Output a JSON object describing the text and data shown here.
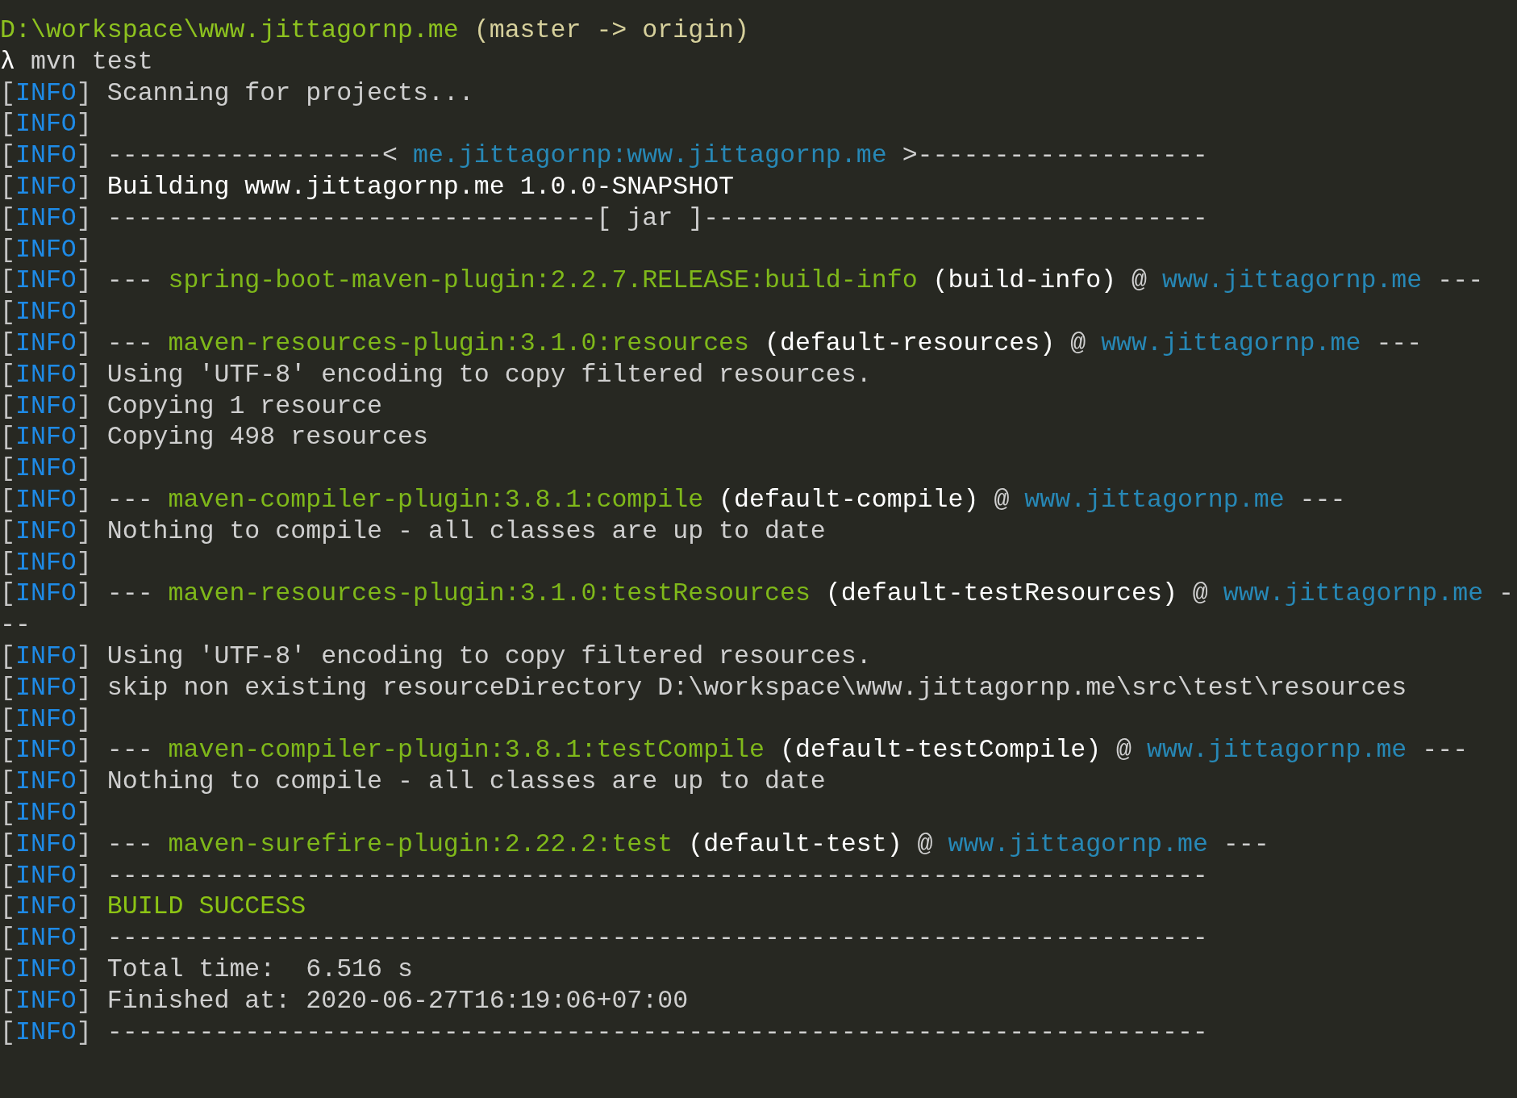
{
  "terminal": {
    "lines": [
      [
        {
          "kind": "path",
          "text": "D:\\workspace\\www.jittagornp.me"
        },
        {
          "kind": "branch",
          "text": " (master -> origin)"
        }
      ],
      [
        {
          "kind": "symbol",
          "text": "λ"
        },
        {
          "kind": "command",
          "text": " mvn test"
        }
      ],
      [
        {
          "kind": "bracket",
          "text": "["
        },
        {
          "kind": "level",
          "text": "INFO"
        },
        {
          "kind": "bracket",
          "text": "]"
        },
        {
          "kind": "text",
          "text": " Scanning for projects..."
        }
      ],
      [
        {
          "kind": "bracket",
          "text": "["
        },
        {
          "kind": "level",
          "text": "INFO"
        },
        {
          "kind": "bracket",
          "text": "]"
        }
      ],
      [
        {
          "kind": "bracket",
          "text": "["
        },
        {
          "kind": "level",
          "text": "INFO"
        },
        {
          "kind": "bracket",
          "text": "]"
        },
        {
          "kind": "text",
          "text": " ------------------< "
        },
        {
          "kind": "artifact",
          "text": "me.jittagornp:www.jittagornp.me"
        },
        {
          "kind": "text",
          "text": " >-------------------"
        }
      ],
      [
        {
          "kind": "bracket",
          "text": "["
        },
        {
          "kind": "level",
          "text": "INFO"
        },
        {
          "kind": "bracket",
          "text": "]"
        },
        {
          "kind": "heading",
          "text": " Building www.jittagornp.me 1.0.0-SNAPSHOT"
        }
      ],
      [
        {
          "kind": "bracket",
          "text": "["
        },
        {
          "kind": "level",
          "text": "INFO"
        },
        {
          "kind": "bracket",
          "text": "]"
        },
        {
          "kind": "text",
          "text": " --------------------------------[ jar ]---------------------------------"
        }
      ],
      [
        {
          "kind": "bracket",
          "text": "["
        },
        {
          "kind": "level",
          "text": "INFO"
        },
        {
          "kind": "bracket",
          "text": "]"
        }
      ],
      [
        {
          "kind": "bracket",
          "text": "["
        },
        {
          "kind": "level",
          "text": "INFO"
        },
        {
          "kind": "bracket",
          "text": "]"
        },
        {
          "kind": "text",
          "text": " --- "
        },
        {
          "kind": "plugin",
          "text": "spring-boot-maven-plugin:2.2.7.RELEASE:build-info"
        },
        {
          "kind": "heading",
          "text": " (build-info)"
        },
        {
          "kind": "text",
          "text": " @ "
        },
        {
          "kind": "artifact",
          "text": "www.jittagornp.me"
        },
        {
          "kind": "text",
          "text": " ---"
        }
      ],
      [
        {
          "kind": "bracket",
          "text": "["
        },
        {
          "kind": "level",
          "text": "INFO"
        },
        {
          "kind": "bracket",
          "text": "]"
        }
      ],
      [
        {
          "kind": "bracket",
          "text": "["
        },
        {
          "kind": "level",
          "text": "INFO"
        },
        {
          "kind": "bracket",
          "text": "]"
        },
        {
          "kind": "text",
          "text": " --- "
        },
        {
          "kind": "plugin",
          "text": "maven-resources-plugin:3.1.0:resources"
        },
        {
          "kind": "heading",
          "text": " (default-resources)"
        },
        {
          "kind": "text",
          "text": " @ "
        },
        {
          "kind": "artifact",
          "text": "www.jittagornp.me"
        },
        {
          "kind": "text",
          "text": " ---"
        }
      ],
      [
        {
          "kind": "bracket",
          "text": "["
        },
        {
          "kind": "level",
          "text": "INFO"
        },
        {
          "kind": "bracket",
          "text": "]"
        },
        {
          "kind": "text",
          "text": " Using 'UTF-8' encoding to copy filtered resources."
        }
      ],
      [
        {
          "kind": "bracket",
          "text": "["
        },
        {
          "kind": "level",
          "text": "INFO"
        },
        {
          "kind": "bracket",
          "text": "]"
        },
        {
          "kind": "text",
          "text": " Copying 1 resource"
        }
      ],
      [
        {
          "kind": "bracket",
          "text": "["
        },
        {
          "kind": "level",
          "text": "INFO"
        },
        {
          "kind": "bracket",
          "text": "]"
        },
        {
          "kind": "text",
          "text": " Copying 498 resources"
        }
      ],
      [
        {
          "kind": "bracket",
          "text": "["
        },
        {
          "kind": "level",
          "text": "INFO"
        },
        {
          "kind": "bracket",
          "text": "]"
        }
      ],
      [
        {
          "kind": "bracket",
          "text": "["
        },
        {
          "kind": "level",
          "text": "INFO"
        },
        {
          "kind": "bracket",
          "text": "]"
        },
        {
          "kind": "text",
          "text": " --- "
        },
        {
          "kind": "plugin",
          "text": "maven-compiler-plugin:3.8.1:compile"
        },
        {
          "kind": "heading",
          "text": " (default-compile)"
        },
        {
          "kind": "text",
          "text": " @ "
        },
        {
          "kind": "artifact",
          "text": "www.jittagornp.me"
        },
        {
          "kind": "text",
          "text": " ---"
        }
      ],
      [
        {
          "kind": "bracket",
          "text": "["
        },
        {
          "kind": "level",
          "text": "INFO"
        },
        {
          "kind": "bracket",
          "text": "]"
        },
        {
          "kind": "text",
          "text": " Nothing to compile - all classes are up to date"
        }
      ],
      [
        {
          "kind": "bracket",
          "text": "["
        },
        {
          "kind": "level",
          "text": "INFO"
        },
        {
          "kind": "bracket",
          "text": "]"
        }
      ],
      [
        {
          "kind": "bracket",
          "text": "["
        },
        {
          "kind": "level",
          "text": "INFO"
        },
        {
          "kind": "bracket",
          "text": "]"
        },
        {
          "kind": "text",
          "text": " --- "
        },
        {
          "kind": "plugin",
          "text": "maven-resources-plugin:3.1.0:testResources"
        },
        {
          "kind": "heading",
          "text": " (default-testResources)"
        },
        {
          "kind": "text",
          "text": " @ "
        },
        {
          "kind": "artifact",
          "text": "www.jittagornp.me"
        },
        {
          "kind": "text",
          "text": " -"
        }
      ],
      [
        {
          "kind": "text",
          "text": "--"
        }
      ],
      [
        {
          "kind": "bracket",
          "text": "["
        },
        {
          "kind": "level",
          "text": "INFO"
        },
        {
          "kind": "bracket",
          "text": "]"
        },
        {
          "kind": "text",
          "text": " Using 'UTF-8' encoding to copy filtered resources."
        }
      ],
      [
        {
          "kind": "bracket",
          "text": "["
        },
        {
          "kind": "level",
          "text": "INFO"
        },
        {
          "kind": "bracket",
          "text": "]"
        },
        {
          "kind": "text",
          "text": " skip non existing resourceDirectory D:\\workspace\\www.jittagornp.me\\src\\test\\resources"
        }
      ],
      [
        {
          "kind": "bracket",
          "text": "["
        },
        {
          "kind": "level",
          "text": "INFO"
        },
        {
          "kind": "bracket",
          "text": "]"
        }
      ],
      [
        {
          "kind": "bracket",
          "text": "["
        },
        {
          "kind": "level",
          "text": "INFO"
        },
        {
          "kind": "bracket",
          "text": "]"
        },
        {
          "kind": "text",
          "text": " --- "
        },
        {
          "kind": "plugin",
          "text": "maven-compiler-plugin:3.8.1:testCompile"
        },
        {
          "kind": "heading",
          "text": " (default-testCompile)"
        },
        {
          "kind": "text",
          "text": " @ "
        },
        {
          "kind": "artifact",
          "text": "www.jittagornp.me"
        },
        {
          "kind": "text",
          "text": " ---"
        }
      ],
      [
        {
          "kind": "bracket",
          "text": "["
        },
        {
          "kind": "level",
          "text": "INFO"
        },
        {
          "kind": "bracket",
          "text": "]"
        },
        {
          "kind": "text",
          "text": " Nothing to compile - all classes are up to date"
        }
      ],
      [
        {
          "kind": "bracket",
          "text": "["
        },
        {
          "kind": "level",
          "text": "INFO"
        },
        {
          "kind": "bracket",
          "text": "]"
        }
      ],
      [
        {
          "kind": "bracket",
          "text": "["
        },
        {
          "kind": "level",
          "text": "INFO"
        },
        {
          "kind": "bracket",
          "text": "]"
        },
        {
          "kind": "text",
          "text": " --- "
        },
        {
          "kind": "plugin",
          "text": "maven-surefire-plugin:2.22.2:test"
        },
        {
          "kind": "heading",
          "text": " (default-test)"
        },
        {
          "kind": "text",
          "text": " @ "
        },
        {
          "kind": "artifact",
          "text": "www.jittagornp.me"
        },
        {
          "kind": "text",
          "text": " ---"
        }
      ],
      [
        {
          "kind": "bracket",
          "text": "["
        },
        {
          "kind": "level",
          "text": "INFO"
        },
        {
          "kind": "bracket",
          "text": "]"
        },
        {
          "kind": "text",
          "text": " ------------------------------------------------------------------------"
        }
      ],
      [
        {
          "kind": "bracket",
          "text": "["
        },
        {
          "kind": "level",
          "text": "INFO"
        },
        {
          "kind": "bracket",
          "text": "]"
        },
        {
          "kind": "success",
          "text": " BUILD SUCCESS"
        }
      ],
      [
        {
          "kind": "bracket",
          "text": "["
        },
        {
          "kind": "level",
          "text": "INFO"
        },
        {
          "kind": "bracket",
          "text": "]"
        },
        {
          "kind": "text",
          "text": " ------------------------------------------------------------------------"
        }
      ],
      [
        {
          "kind": "bracket",
          "text": "["
        },
        {
          "kind": "level",
          "text": "INFO"
        },
        {
          "kind": "bracket",
          "text": "]"
        },
        {
          "kind": "text",
          "text": " Total time:  6.516 s"
        }
      ],
      [
        {
          "kind": "bracket",
          "text": "["
        },
        {
          "kind": "level",
          "text": "INFO"
        },
        {
          "kind": "bracket",
          "text": "]"
        },
        {
          "kind": "text",
          "text": " Finished at: 2020-06-27T16:19:06+07:00"
        }
      ],
      [
        {
          "kind": "bracket",
          "text": "["
        },
        {
          "kind": "level",
          "text": "INFO"
        },
        {
          "kind": "bracket",
          "text": "]"
        },
        {
          "kind": "text",
          "text": " ------------------------------------------------------------------------"
        }
      ]
    ]
  }
}
